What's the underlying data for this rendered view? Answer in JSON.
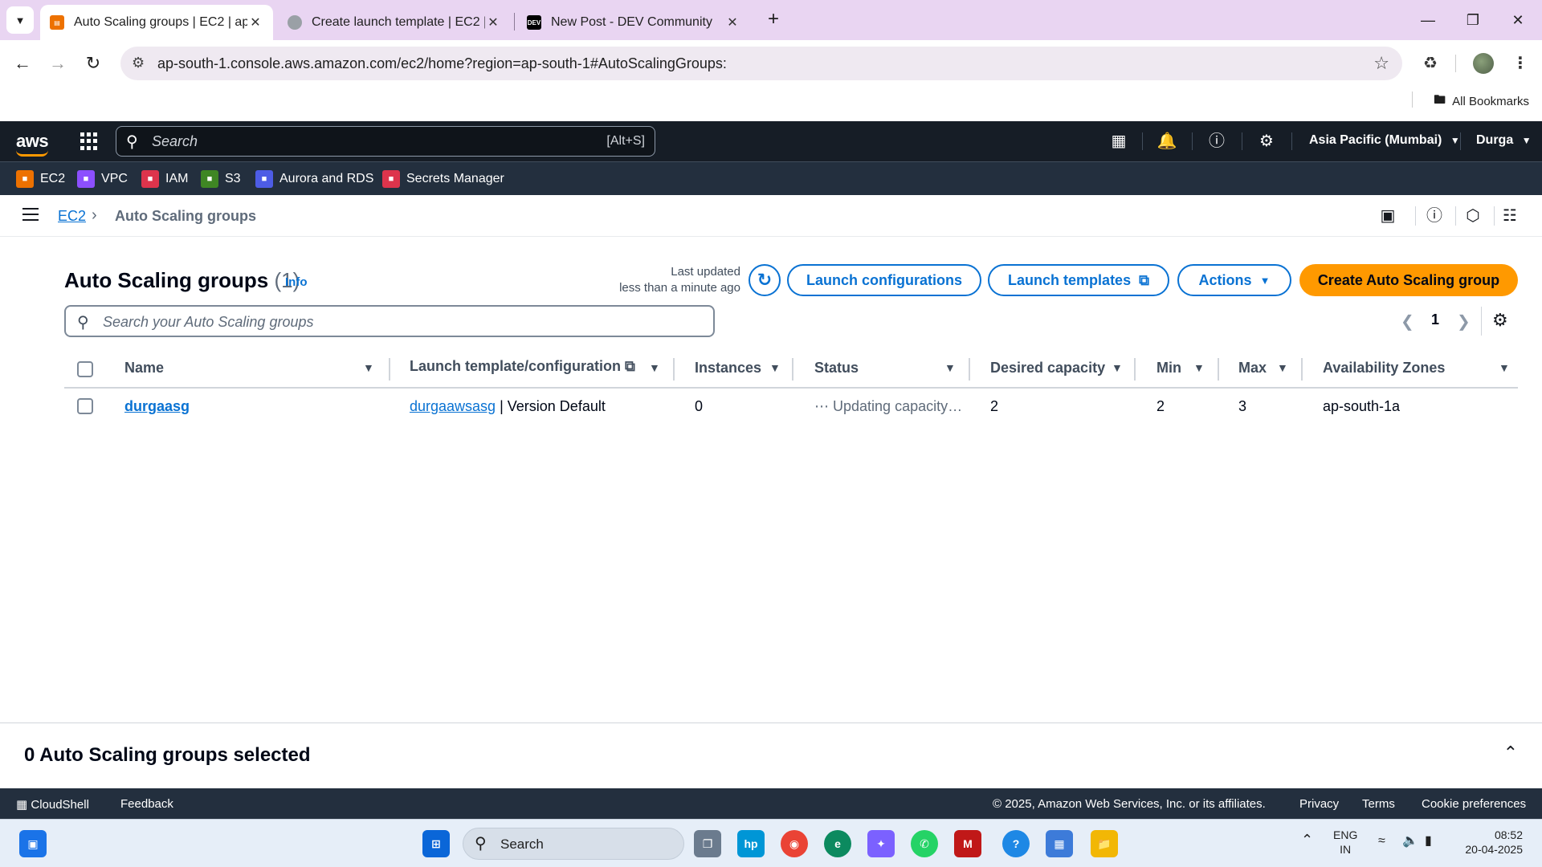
{
  "browser": {
    "tabs": [
      {
        "title": "Auto Scaling groups | EC2 | ap-s",
        "favicon": "aws-icon"
      },
      {
        "title": "Create launch template | EC2 | a",
        "favicon": "globe-icon"
      },
      {
        "title": "New Post - DEV Community",
        "favicon": "dev-icon",
        "favicon_text": "DEV"
      }
    ],
    "url": "ap-south-1.console.aws.amazon.com/ec2/home?region=ap-south-1#AutoScalingGroups:",
    "bookmarks_label": "All Bookmarks"
  },
  "aws_header": {
    "logo": "aws",
    "search_placeholder": "Search",
    "search_shortcut": "[Alt+S]",
    "region": "Asia Pacific (Mumbai)",
    "user": "Durga"
  },
  "favorites": [
    {
      "label": "EC2",
      "color": "#ed7100"
    },
    {
      "label": "VPC",
      "color": "#8c4fff"
    },
    {
      "label": "IAM",
      "color": "#dd344c"
    },
    {
      "label": "S3",
      "color": "#3f8624"
    },
    {
      "label": "Aurora and RDS",
      "color": "#4d5ce5"
    },
    {
      "label": "Secrets Manager",
      "color": "#dd344c"
    }
  ],
  "breadcrumb": {
    "parent": "EC2",
    "current": "Auto Scaling groups"
  },
  "page": {
    "title": "Auto Scaling groups",
    "count": "(1)",
    "info": "Info",
    "last_updated_label": "Last updated",
    "last_updated_value": "less than a minute ago",
    "buttons": {
      "launch_configurations": "Launch configurations",
      "launch_templates": "Launch templates",
      "actions": "Actions",
      "create": "Create Auto Scaling group"
    },
    "search_placeholder": "Search your Auto Scaling groups",
    "page_number": "1"
  },
  "table": {
    "columns": [
      "Name",
      "Launch template/configuration",
      "Instances",
      "Status",
      "Desired capacity",
      "Min",
      "Max",
      "Availability Zones"
    ],
    "rows": [
      {
        "name": "durgaasg",
        "template_link": "durgaawsasg",
        "template_version": "| Version Default",
        "instances": "0",
        "status": "Updating capacity…",
        "desired": "2",
        "min": "2",
        "max": "3",
        "az": "ap-south-1a"
      }
    ]
  },
  "split_panel": {
    "title": "0 Auto Scaling groups selected"
  },
  "footer": {
    "cloudshell": "CloudShell",
    "feedback": "Feedback",
    "copyright": "© 2025, Amazon Web Services, Inc. or its affiliates.",
    "privacy": "Privacy",
    "terms": "Terms",
    "cookies": "Cookie preferences"
  },
  "taskbar": {
    "search_placeholder": "Search",
    "lang_top": "ENG",
    "lang_bottom": "IN",
    "time": "08:52",
    "date": "20-04-2025"
  }
}
